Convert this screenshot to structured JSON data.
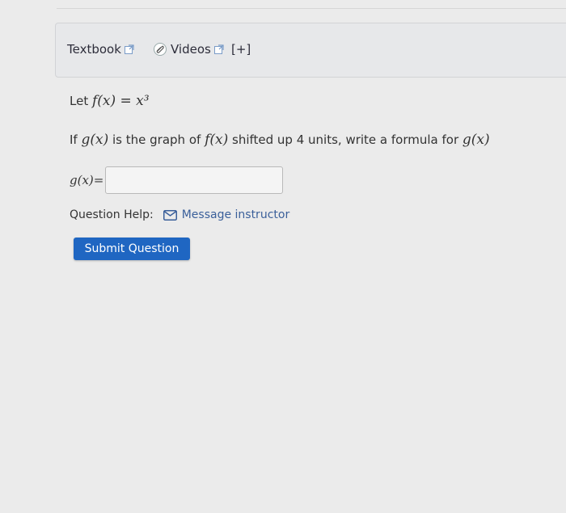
{
  "resources": {
    "textbook_label": "Textbook",
    "videos_label": "Videos",
    "more_label": "[+]"
  },
  "question": {
    "let_prefix": "Let",
    "function_def": "f(x) = x³",
    "prompt_parts": {
      "p1": "If",
      "g": "g(x)",
      "p2": "is the graph of",
      "f": "f(x)",
      "p3": "shifted up 4 units, write a formula for",
      "g2": "g(x)"
    },
    "answer_label": "g(x)=",
    "answer_value": ""
  },
  "help": {
    "label": "Question Help:",
    "link_label": "Message instructor"
  },
  "submit": {
    "label": "Submit Question"
  },
  "colors": {
    "accent": "#1f66c2",
    "link": "#3a5f9a"
  },
  "icons": {
    "external": "external-link-icon",
    "clip": "paperclip-icon",
    "mail": "mail-icon"
  }
}
